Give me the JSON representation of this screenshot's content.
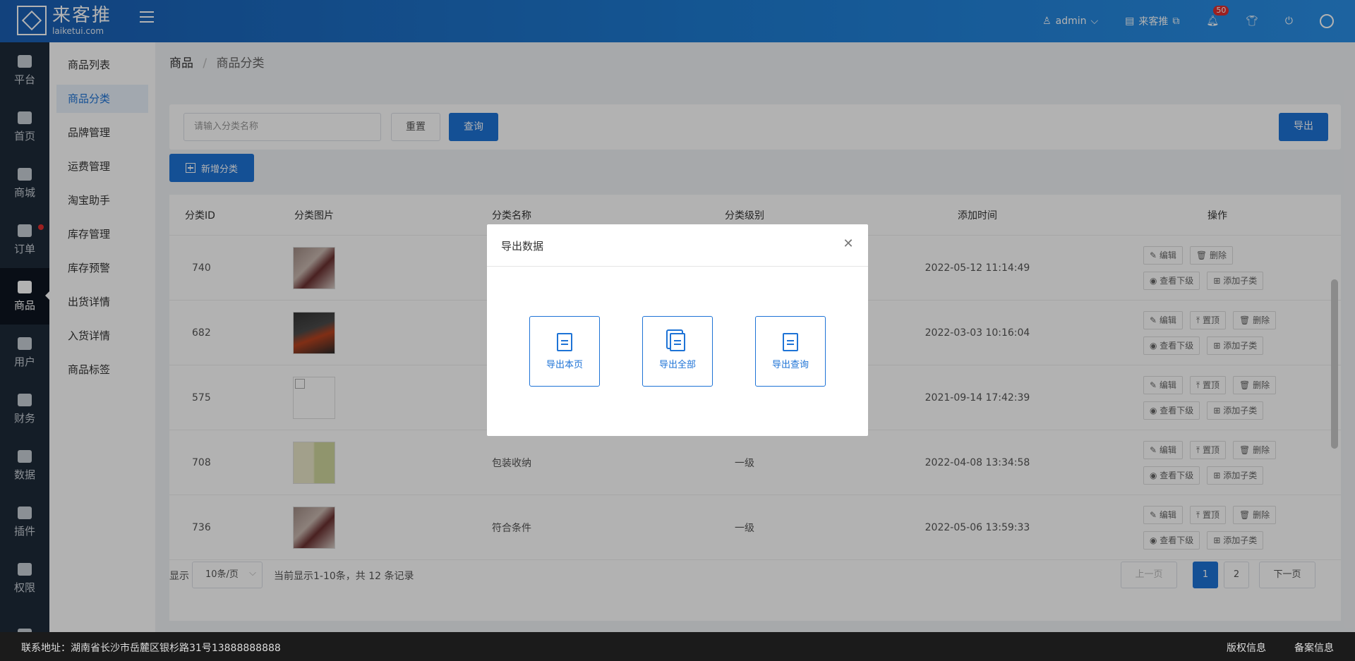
{
  "header": {
    "brand_name": "来客推",
    "brand_domain": "laiketui.com",
    "user": "admin",
    "store": "来客推",
    "notification_count": "50"
  },
  "sidebar_main": [
    {
      "label": "平台",
      "icon": "dollar-icon"
    },
    {
      "label": "首页",
      "icon": "home-icon"
    },
    {
      "label": "商城",
      "icon": "store-icon"
    },
    {
      "label": "订单",
      "icon": "clipboard-icon"
    },
    {
      "label": "商品",
      "icon": "bag-icon",
      "active": true
    },
    {
      "label": "用户",
      "icon": "user-icon"
    },
    {
      "label": "财务",
      "icon": "wallet-icon"
    },
    {
      "label": "数据",
      "icon": "pie-icon"
    },
    {
      "label": "插件",
      "icon": "puzzle-icon"
    },
    {
      "label": "权限",
      "icon": "shield-icon"
    },
    {
      "label": "",
      "icon": "image-icon"
    }
  ],
  "sidebar_sub": [
    "商品列表",
    "商品分类",
    "品牌管理",
    "运费管理",
    "淘宝助手",
    "库存管理",
    "库存预警",
    "出货详情",
    "入货详情",
    "商品标签"
  ],
  "breadcrumb": {
    "root": "商品",
    "sep": "/",
    "current": "商品分类"
  },
  "search": {
    "placeholder": "请输入分类名称",
    "reset": "重置",
    "query": "查询",
    "export": "导出",
    "add": "新增分类"
  },
  "table": {
    "headers": [
      "分类ID",
      "分类图片",
      "分类名称",
      "分类级别",
      "添加时间",
      "操作"
    ],
    "rows": [
      {
        "id": "740",
        "name": "",
        "level": "",
        "time": "2022-05-12 11:14:49"
      },
      {
        "id": "682",
        "name": "",
        "level": "",
        "time": "2022-03-03 10:16:04"
      },
      {
        "id": "575",
        "name": "",
        "level": "",
        "time": "2021-09-14 17:42:39"
      },
      {
        "id": "708",
        "name": "包装收纳",
        "level": "一级",
        "time": "2022-04-08 13:34:58"
      },
      {
        "id": "736",
        "name": "符合条件",
        "level": "一级",
        "time": "2022-05-06 13:59:33"
      }
    ],
    "ops": {
      "edit": "编辑",
      "delete": "删除",
      "top": "置顶",
      "view_sub": "查看下级",
      "add_sub": "添加子类"
    }
  },
  "pagination": {
    "show": "显示",
    "page_size": "10条/页",
    "info": "当前显示1-10条，共 12 条记录",
    "prev": "上一页",
    "page1": "1",
    "page2": "2",
    "next": "下一页"
  },
  "footer": {
    "address": "联系地址：湖南省长沙市岳麓区银杉路31号13888888888",
    "copyright": "版权信息",
    "icp": "备案信息"
  },
  "modal": {
    "title": "导出数据",
    "options": [
      "导出本页",
      "导出全部",
      "导出查询"
    ]
  }
}
